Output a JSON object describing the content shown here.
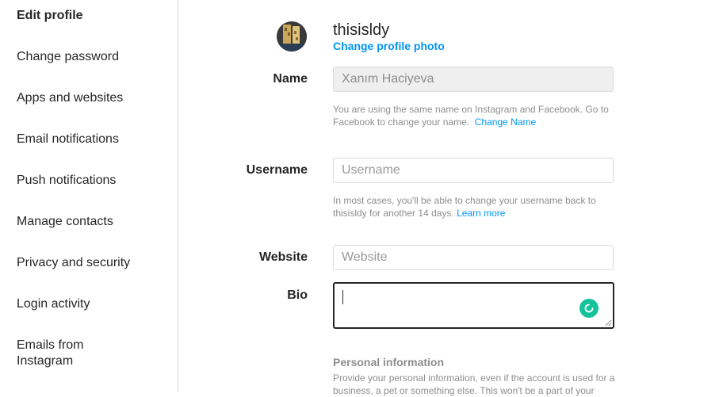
{
  "sidebar": {
    "items": [
      {
        "label": "Edit profile",
        "active": true
      },
      {
        "label": "Change password"
      },
      {
        "label": "Apps and websites"
      },
      {
        "label": "Email notifications"
      },
      {
        "label": "Push notifications"
      },
      {
        "label": "Manage contacts"
      },
      {
        "label": "Privacy and security"
      },
      {
        "label": "Login activity"
      },
      {
        "label": "Emails from Instagram"
      }
    ]
  },
  "profile": {
    "username": "thisisldy",
    "change_photo": "Change profile photo"
  },
  "form": {
    "name": {
      "label": "Name",
      "value": "Xanım Haciyeva",
      "help_text": "You are using the same name on Instagram and Facebook. Go to Facebook to change your name.",
      "help_link": "Change Name"
    },
    "username": {
      "label": "Username",
      "placeholder": "Username",
      "help_text": "In most cases, you'll be able to change your username back to thisisldy for another 14 days.",
      "help_link": "Learn more"
    },
    "website": {
      "label": "Website",
      "placeholder": "Website"
    },
    "bio": {
      "label": "Bio",
      "value": ""
    }
  },
  "personal_info": {
    "title": "Personal information",
    "text": "Provide your personal information, even if the account is used for a business, a pet or something else. This won't be a part of your"
  },
  "colors": {
    "link": "#0095f6",
    "grammar_green": "#15c39a"
  }
}
